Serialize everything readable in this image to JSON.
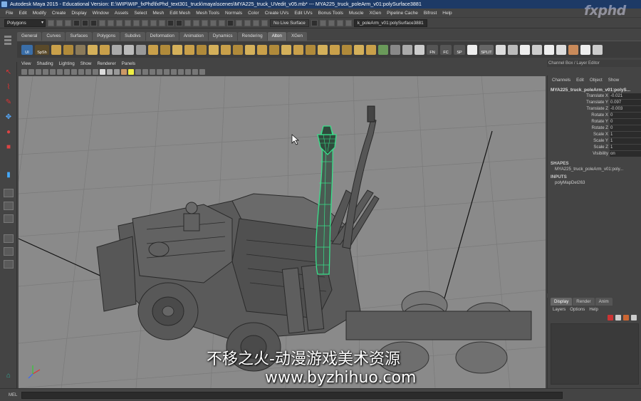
{
  "window": {
    "title": "Autodesk Maya 2015 - Educational Version: E:\\WIP\\WIP_fxPhd\\fxPhd_text301_truck\\maya\\scenes\\MYA225_truck_UVedit_v05.mb* --- MYA225_truck_poleArm_v01:polySurface3881"
  },
  "menubar": [
    "File",
    "Edit",
    "Modify",
    "Create",
    "Display",
    "Window",
    "Assets",
    "Select",
    "Mesh",
    "Edit Mesh",
    "Mesh Tools",
    "Normals",
    "Color",
    "Create UVs",
    "Edit UVs",
    "Bonus Tools",
    "Muscle",
    "XGen",
    "Pipeline Cache",
    "Bifrost",
    "Help"
  ],
  "statusline": {
    "mode": "Polygons",
    "live_surface": "No Live Surface",
    "object_field": "k_poleArm_v01:polySurface3881"
  },
  "shelf": {
    "tabs": [
      "General",
      "Curves",
      "Surfaces",
      "Polygons",
      "Subdivs",
      "Deformation",
      "Animation",
      "Dynamics",
      "Rendering",
      "Alton",
      "XGen"
    ],
    "active_tab": "Alton",
    "labels": [
      "UI",
      "SpSh",
      "FN",
      "FC",
      "SP",
      "SPLIT"
    ]
  },
  "panel": {
    "menus": [
      "View",
      "Shading",
      "Lighting",
      "Show",
      "Renderer",
      "Panels"
    ]
  },
  "channel_box": {
    "header": "Channel Box / Layer Editor",
    "menus": [
      "Channels",
      "Edit",
      "Object",
      "Show"
    ],
    "object_name": "MYA225_truck_poleArm_v01:polyS...",
    "attributes": [
      {
        "name": "Translate X",
        "value": "-0.021"
      },
      {
        "name": "Translate Y",
        "value": "0.097"
      },
      {
        "name": "Translate Z",
        "value": "-0.003"
      },
      {
        "name": "Rotate X",
        "value": "0"
      },
      {
        "name": "Rotate Y",
        "value": "0"
      },
      {
        "name": "Rotate Z",
        "value": "0"
      },
      {
        "name": "Scale X",
        "value": "1"
      },
      {
        "name": "Scale Y",
        "value": "1"
      },
      {
        "name": "Scale Z",
        "value": "1"
      },
      {
        "name": "Visibility",
        "value": "on"
      }
    ],
    "shapes_label": "SHAPES",
    "shape_item": "MYA225_truck_poleArm_v01:poly...",
    "inputs_label": "INPUTS",
    "input_item": "polyMapDel263"
  },
  "layer_editor": {
    "tabs": [
      "Display",
      "Render",
      "Anim"
    ],
    "active_tab": "Display",
    "menus": [
      "Layers",
      "Options",
      "Help"
    ]
  },
  "helpline": {
    "mel_label": "MEL"
  },
  "watermarks": {
    "logo": "fxphd",
    "cn": "不移之火-动漫游戏美术资源",
    "url": "www.byzhihuo.com"
  },
  "colors": {
    "title_bg": "#1d3a66",
    "viewport_bg": "#8a8a8a",
    "selection_green": "#38e08a",
    "ui_bg": "#444444"
  }
}
